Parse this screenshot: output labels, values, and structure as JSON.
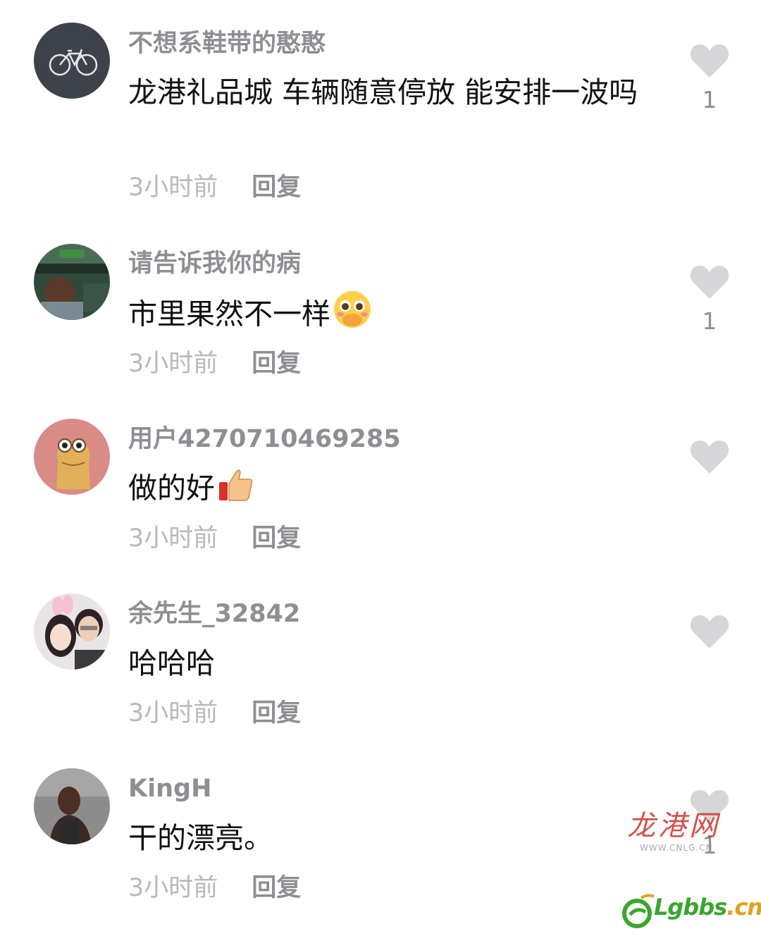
{
  "comments": [
    {
      "username": "不想系鞋带的憨憨",
      "text": "龙港礼品城 车辆随意停放 能安排一波吗",
      "emoji": "",
      "time": "3小时前",
      "reply_label": "回复",
      "like_count": "1",
      "avatar_icon": "bicycle-avatar"
    },
    {
      "username": "请告诉我你的病",
      "text": "市里果然不一样",
      "emoji": "shy-face-emoji",
      "time": "3小时前",
      "reply_label": "回复",
      "like_count": "1",
      "avatar_icon": "person-photo-avatar"
    },
    {
      "username": "用户4270710469285",
      "text": "做的好",
      "emoji": "thumbs-up-emoji",
      "time": "3小时前",
      "reply_label": "回复",
      "like_count": "",
      "avatar_icon": "cartoon-creature-avatar"
    },
    {
      "username": "余先生_32842",
      "text": "哈哈哈",
      "emoji": "",
      "time": "3小时前",
      "reply_label": "回复",
      "like_count": "",
      "avatar_icon": "couple-photo-avatar"
    },
    {
      "username": "KingH",
      "text": "干的漂亮。",
      "emoji": "",
      "time": "3小时前",
      "reply_label": "回复",
      "like_count": "1",
      "avatar_icon": "athlete-photo-avatar"
    }
  ],
  "watermark": {
    "text": "龙港网",
    "url": "WWW.CNLG.CN"
  },
  "logo": {
    "brand": "Lgbbs",
    "tld": ".cn"
  },
  "colors": {
    "username": "#8e8e93",
    "text": "#111111",
    "time": "#b8b8bd",
    "heart": "#d6d6d8",
    "logo_green": "#3aa62e",
    "logo_orange": "#e0a11b"
  }
}
